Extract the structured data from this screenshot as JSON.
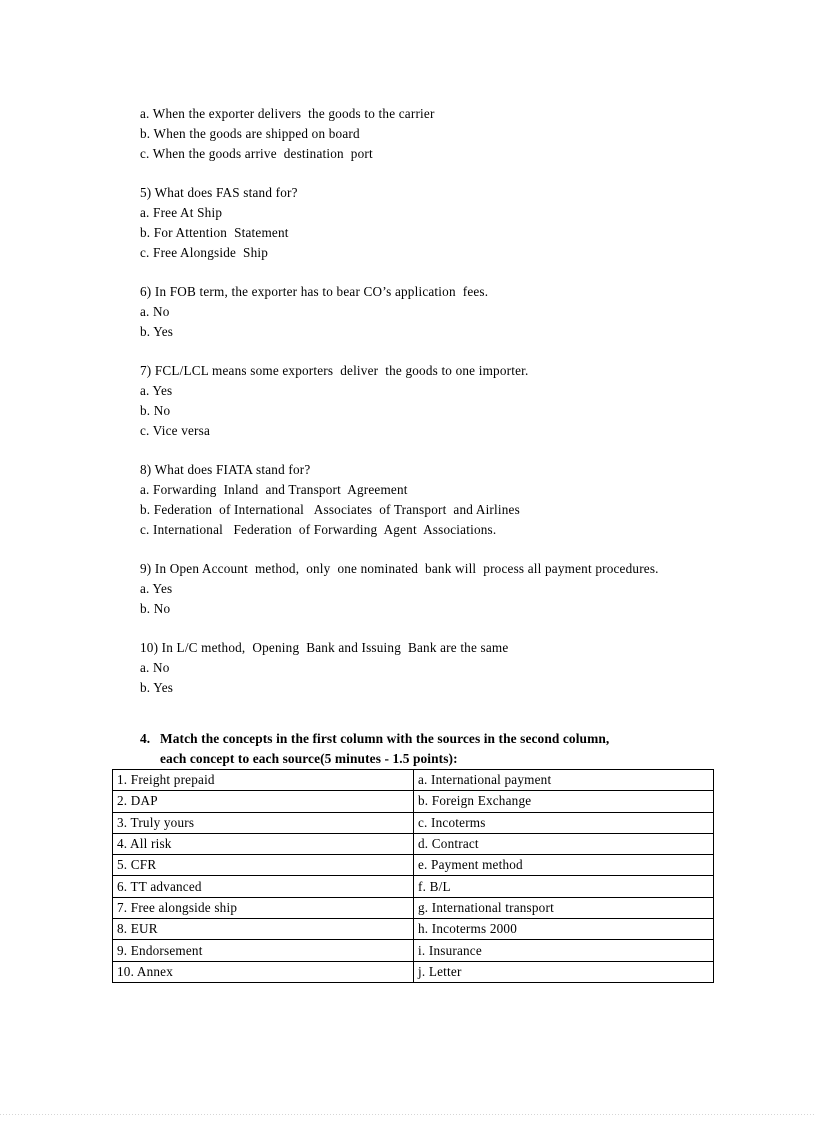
{
  "document": {
    "carryover_options": [
      "a. When the exporter delivers  the goods to the carrier",
      "b. When the goods are shipped on board",
      "c. When the goods arrive  destination  port"
    ],
    "questions": [
      {
        "number": "5)",
        "stem": "5) What does FAS stand for?",
        "options": [
          "a. Free At Ship",
          "b. For Attention  Statement",
          "c. Free Alongside  Ship"
        ]
      },
      {
        "number": "6)",
        "stem": "6) In FOB term, the exporter has to bear CO’s application  fees.",
        "options": [
          "a. No",
          "b. Yes"
        ]
      },
      {
        "number": "7)",
        "stem": "7) FCL/LCL means some exporters  deliver  the goods to one importer.",
        "options": [
          "a. Yes",
          "b. No",
          "c. Vice versa"
        ]
      },
      {
        "number": "8)",
        "stem": "8) What does FIATA stand for?",
        "options": [
          "a. Forwarding  Inland  and Transport  Agreement",
          "b. Federation  of International   Associates  of Transport  and Airlines",
          "c. International   Federation  of Forwarding  Agent  Associations."
        ]
      },
      {
        "number": "9)",
        "stem": "9) In Open Account  method,  only  one nominated  bank will  process all payment procedures.",
        "options": [
          "a. Yes",
          "b. No"
        ]
      },
      {
        "number": "10)",
        "stem": "10) In L/C method,  Opening  Bank and Issuing  Bank are the same",
        "options": [
          "a. No",
          "b. Yes"
        ]
      }
    ],
    "section": {
      "number": "4.",
      "heading_line1": "Match the concepts in the first  column  with  the sources in the second column,",
      "heading_line2": "each concept to each source(5 minutes - 1.5 points):"
    },
    "match_table": {
      "rows": [
        {
          "left": "1. Freight  prepaid",
          "right": "a. International   payment"
        },
        {
          "left": "2. DAP",
          "right": "b. Foreign  Exchange"
        },
        {
          "left": "3. Truly  yours",
          "right": "c. Incoterms"
        },
        {
          "left": "4. All risk",
          "right": "d. Contract"
        },
        {
          "left": "5. CFR",
          "right": "e. Payment method"
        },
        {
          "left": "6. TT advanced",
          "right": "f. B/L"
        },
        {
          "left": "7. Free alongside  ship",
          "right": "g. International   transport"
        },
        {
          "left": "8. EUR",
          "right": "h. Incoterms  2000"
        },
        {
          "left": "9. Endorsement",
          "right": "i. Insurance"
        },
        {
          "left": "10. Annex",
          "right": "j. Letter"
        }
      ]
    }
  }
}
